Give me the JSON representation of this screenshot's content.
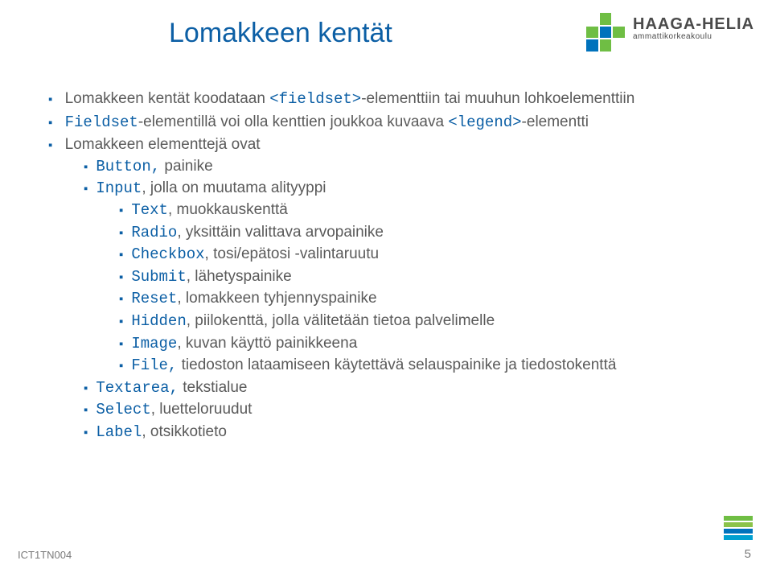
{
  "title": "Lomakkeen kentät",
  "logo": {
    "main": "HAAGA-HELIA",
    "sub": "ammattikorkeakoulu"
  },
  "bullets": {
    "b1_pre": "Lomakkeen kentät koodataan ",
    "b1_code": "<fieldset>",
    "b1_post": "-elementtiin tai muuhun lohkoelementtiin",
    "b2_code": "Fieldset",
    "b2_post": "-elementillä voi olla kenttien joukkoa kuvaava ",
    "b2_code2": "<legend>",
    "b2_post2": "-elementti",
    "b3": "Lomakkeen elementtejä ovat",
    "b3a_code": "Button,",
    "b3a_text": " painike",
    "b3b_code": "Input",
    "b3b_text": ", jolla on muutama alityyppi",
    "b3b1_code": "Text",
    "b3b1_text": ", muokkauskenttä",
    "b3b2_code": "Radio",
    "b3b2_text": ", yksittäin valittava arvopainike",
    "b3b3_code": "Checkbox",
    "b3b3_text": ", tosi/epätosi -valintaruutu",
    "b3b4_code": "Submit",
    "b3b4_text": ", lähetyspainike",
    "b3b5_code": "Reset",
    "b3b5_text": ", lomakkeen tyhjennyspainike",
    "b3b6_code": "Hidden",
    "b3b6_text": ", piilokenttä, jolla välitetään tietoa palvelimelle",
    "b3b7_code": "Image",
    "b3b7_text": ", kuvan käyttö painikkeena",
    "b3b8_code": "File,",
    "b3b8_text": "  tiedoston lataamiseen käytettävä selauspainike ja tiedostokenttä",
    "b3c_code": "Textarea,",
    "b3c_text": " tekstialue",
    "b3d_code": "Select",
    "b3d_text": ", luetteloruudut",
    "b3e_code": "Label",
    "b3e_text": ", otsikkotieto"
  },
  "footer": {
    "code": "ICT1TN004",
    "page": "5"
  }
}
